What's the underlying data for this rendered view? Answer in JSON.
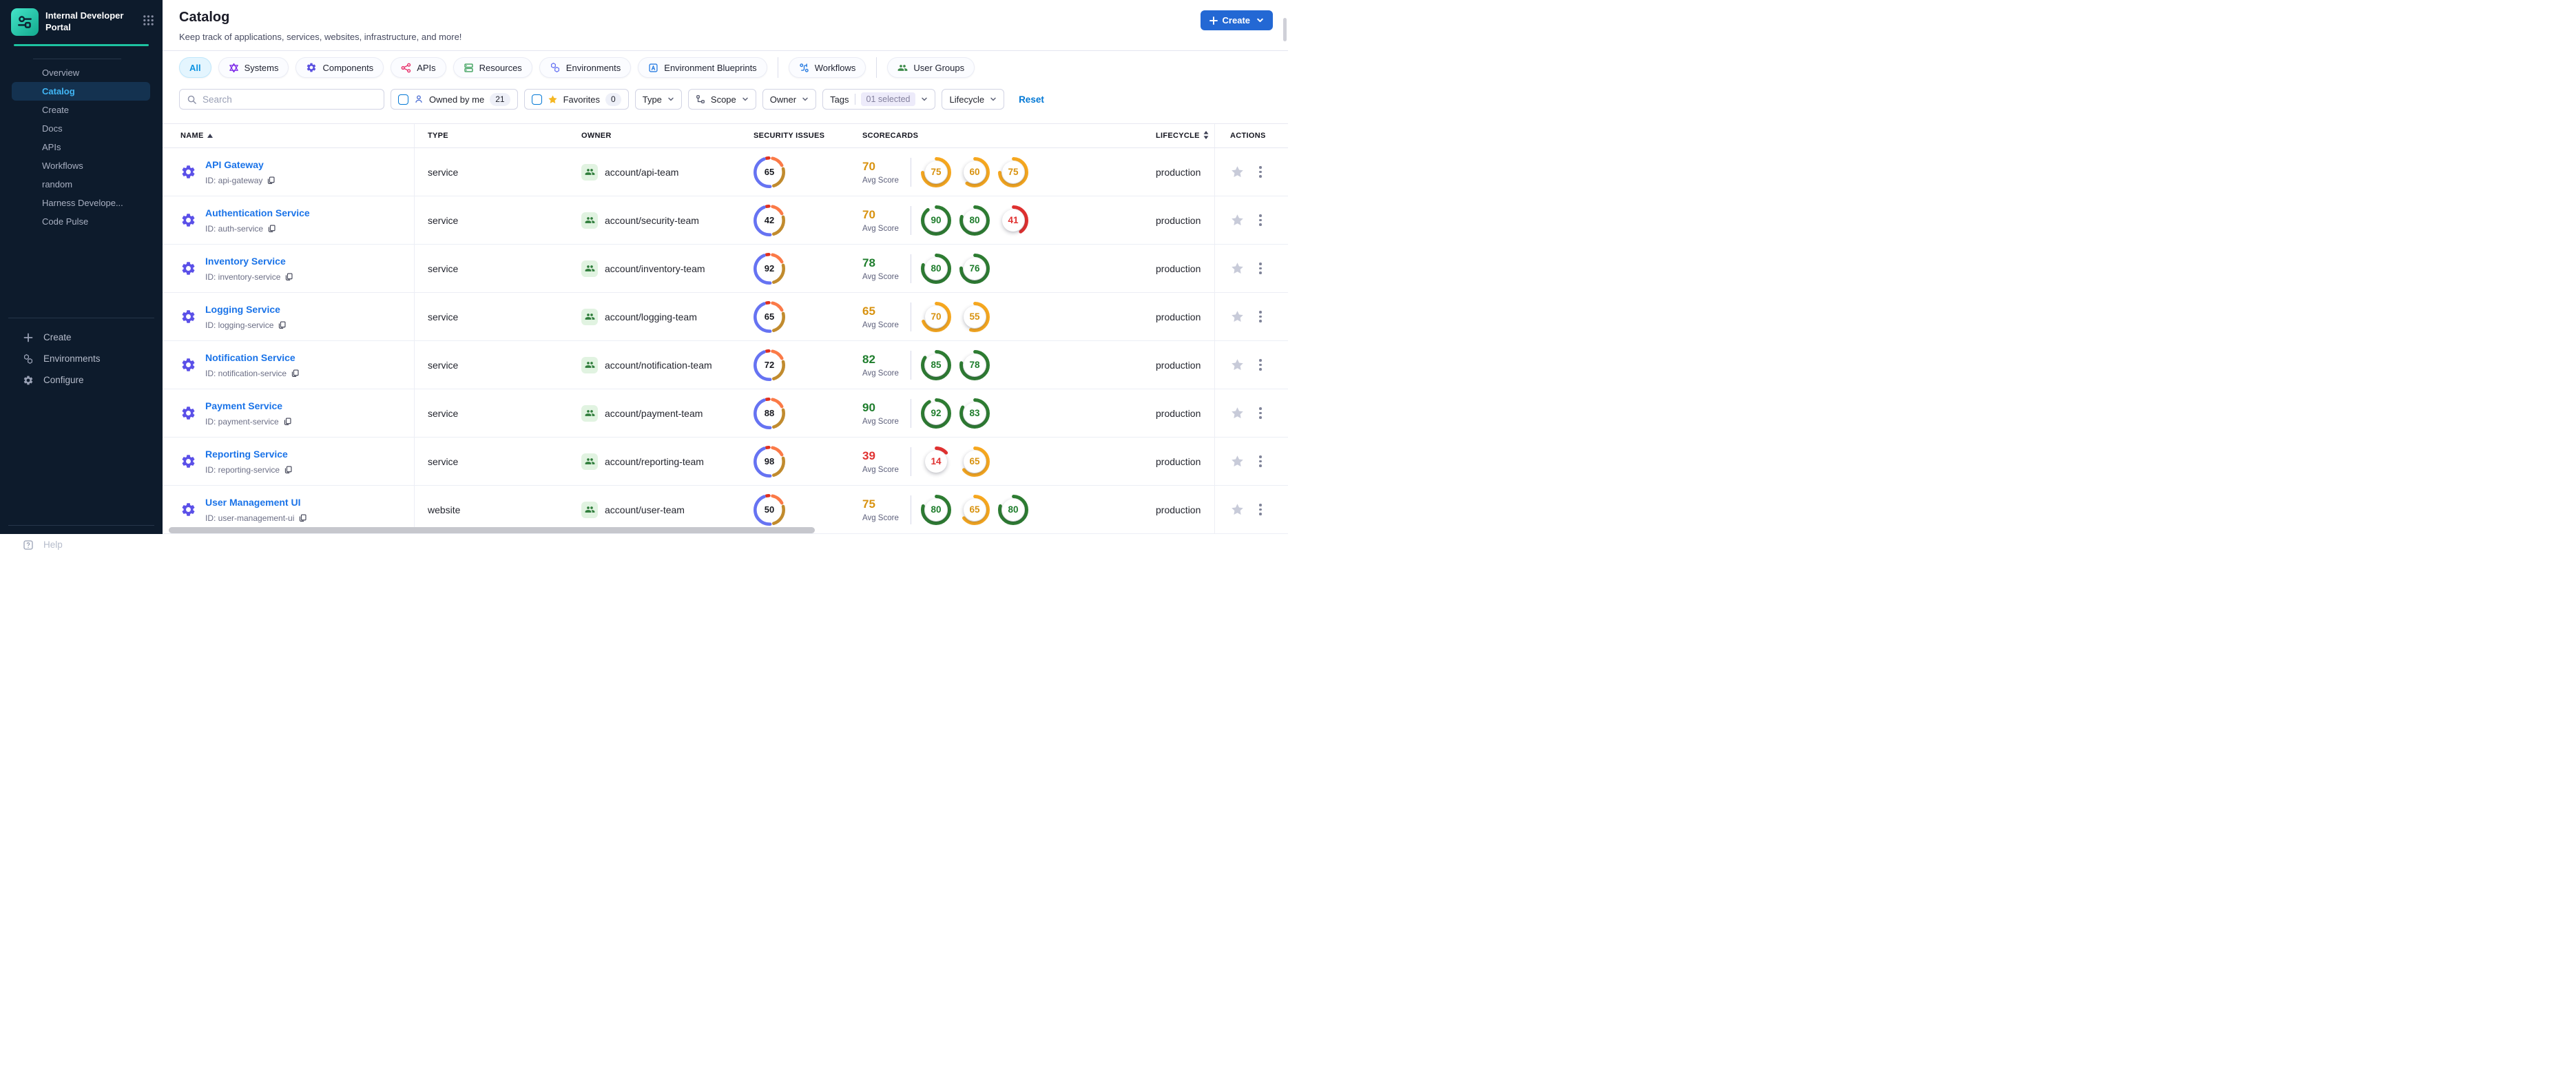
{
  "app": {
    "title": "Internal Developer Portal"
  },
  "sidebar": {
    "items": [
      {
        "label": "Overview",
        "active": false
      },
      {
        "label": "Catalog",
        "active": true
      },
      {
        "label": "Create",
        "active": false
      },
      {
        "label": "Docs",
        "active": false
      },
      {
        "label": "APIs",
        "active": false
      },
      {
        "label": "Workflows",
        "active": false
      },
      {
        "label": "random",
        "active": false
      },
      {
        "label": "Harness Develope...",
        "active": false
      },
      {
        "label": "Code Pulse",
        "active": false
      }
    ],
    "bottom_items": [
      {
        "label": "Create",
        "icon": "plus-icon"
      },
      {
        "label": "Environments",
        "icon": "hexagons-icon"
      },
      {
        "label": "Configure",
        "icon": "gear-icon"
      }
    ],
    "help_label": "Help"
  },
  "header": {
    "title": "Catalog",
    "subtitle": "Keep track of applications, services, websites, infrastructure, and more!",
    "create_label": "Create"
  },
  "tabs": [
    {
      "label": "All",
      "active": true,
      "icon": "",
      "color": ""
    },
    {
      "label": "Systems",
      "active": false,
      "icon": "systems-icon",
      "color": "#7d2ae8"
    },
    {
      "label": "Components",
      "active": false,
      "icon": "components-gear-icon",
      "color": "#5a50e0"
    },
    {
      "label": "APIs",
      "active": false,
      "icon": "apis-icon",
      "color": "#e8336d"
    },
    {
      "label": "Resources",
      "active": false,
      "icon": "resources-icon",
      "color": "#3da05c"
    },
    {
      "label": "Environments",
      "active": false,
      "icon": "hexagons-icon",
      "color": "#6673f2"
    },
    {
      "label": "Environment Blueprints",
      "active": false,
      "icon": "blueprint-icon",
      "color": "#2a7de1"
    },
    {
      "label": "Workflows",
      "active": false,
      "icon": "workflows-icon",
      "color": "#2a7de1",
      "divider_before": true
    },
    {
      "label": "User Groups",
      "active": false,
      "icon": "user-groups-icon",
      "color": "#3c8a49",
      "divider_before": true
    }
  ],
  "filters": {
    "search_placeholder": "Search",
    "owned_by_me": {
      "label": "Owned by me",
      "count": "21"
    },
    "favorites": {
      "label": "Favorites",
      "count": "0"
    },
    "type_label": "Type",
    "scope_label": "Scope",
    "owner_label": "Owner",
    "tags_label": "Tags",
    "tags_selected": "01 selected",
    "lifecycle_label": "Lifecycle",
    "reset_label": "Reset"
  },
  "table": {
    "columns": [
      {
        "label": "NAME",
        "sort": "asc"
      },
      {
        "label": "TYPE",
        "sort": ""
      },
      {
        "label": "OWNER",
        "sort": ""
      },
      {
        "label": "SECURITY ISSUES",
        "sort": ""
      },
      {
        "label": "SCORECARDS",
        "sort": ""
      },
      {
        "label": "LIFECYCLE",
        "sort": "updown"
      },
      {
        "label": "ACTIONS",
        "sort": ""
      }
    ],
    "avg_label": "Avg Score",
    "rows": [
      {
        "name": "API Gateway",
        "id": "ID: api-gateway",
        "type": "service",
        "owner": "account/api-team",
        "security": 65,
        "avg": 70,
        "scores": [
          75,
          60,
          75
        ],
        "lifecycle": "production"
      },
      {
        "name": "Authentication Service",
        "id": "ID: auth-service",
        "type": "service",
        "owner": "account/security-team",
        "security": 42,
        "avg": 70,
        "scores": [
          90,
          80,
          41
        ],
        "lifecycle": "production"
      },
      {
        "name": "Inventory Service",
        "id": "ID: inventory-service",
        "type": "service",
        "owner": "account/inventory-team",
        "security": 92,
        "avg": 78,
        "scores": [
          80,
          76
        ],
        "lifecycle": "production"
      },
      {
        "name": "Logging Service",
        "id": "ID: logging-service",
        "type": "service",
        "owner": "account/logging-team",
        "security": 65,
        "avg": 65,
        "scores": [
          70,
          55
        ],
        "lifecycle": "production"
      },
      {
        "name": "Notification Service",
        "id": "ID: notification-service",
        "type": "service",
        "owner": "account/notification-team",
        "security": 72,
        "avg": 82,
        "scores": [
          85,
          78
        ],
        "lifecycle": "production"
      },
      {
        "name": "Payment Service",
        "id": "ID: payment-service",
        "type": "service",
        "owner": "account/payment-team",
        "security": 88,
        "avg": 90,
        "scores": [
          92,
          83
        ],
        "lifecycle": "production"
      },
      {
        "name": "Reporting Service",
        "id": "ID: reporting-service",
        "type": "service",
        "owner": "account/reporting-team",
        "security": 98,
        "avg": 39,
        "scores": [
          14,
          65
        ],
        "lifecycle": "production"
      },
      {
        "name": "User Management UI",
        "id": "ID: user-management-ui",
        "type": "website",
        "owner": "account/user-team",
        "security": 50,
        "avg": 75,
        "scores": [
          80,
          65,
          80
        ],
        "lifecycle": "production"
      }
    ]
  },
  "colors": {
    "primary_blue": "#2368d4",
    "link_blue": "#1a73e8",
    "accent_teal": "#1dc3a1",
    "score_green_stroke": "#2e7d32",
    "score_green_text": "#1e7d2c",
    "score_orange_stroke": "#f7a81f",
    "score_orange_text": "#d8920f",
    "score_red_stroke": "#e03130",
    "score_red_text": "#e03130",
    "donut_blue": "#6673f2",
    "donut_red": "#e0301e",
    "donut_orange": "#fb7a47",
    "donut_amber": "#c18b2e",
    "owner_green": "#2f7d3b",
    "star_yellow": "#f5b722"
  }
}
